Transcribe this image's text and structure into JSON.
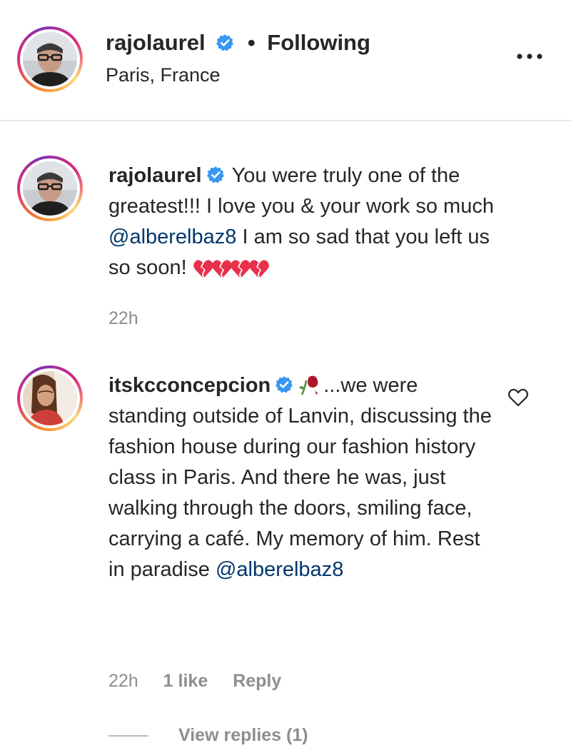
{
  "post_header": {
    "username": "rajolaurel",
    "separator": "•",
    "follow_status": "Following",
    "location": "Paris, France",
    "more_icon": "more-options-icon"
  },
  "comments": [
    {
      "username": "rajolaurel",
      "text_before": "You were truly one of the greatest!!! I love you & your work so much",
      "mention": "@alberelbaz8",
      "text_after": "I am so sad that you left us so soon!",
      "emoji": "broken-hearts",
      "time": "22h"
    },
    {
      "username": "itskcconcepcion",
      "emoji": "wilted-rose",
      "text": "...we were standing outside of Lanvin, discussing the fashion house during our fashion history class in Paris. And there he was, just walking through the doors, smiling face, carrying a café. My memory of him. Rest in paradise",
      "mention": "@alberelbaz8",
      "time": "22h",
      "likes": "1 like",
      "reply_label": "Reply",
      "like_icon": "heart-outline-icon"
    }
  ],
  "view_replies": "View replies (1)",
  "colors": {
    "text": "#262626",
    "secondary": "#8e8e8e",
    "mention": "#00376b",
    "verified": "#3897f0",
    "divider": "#e6e6e6"
  }
}
